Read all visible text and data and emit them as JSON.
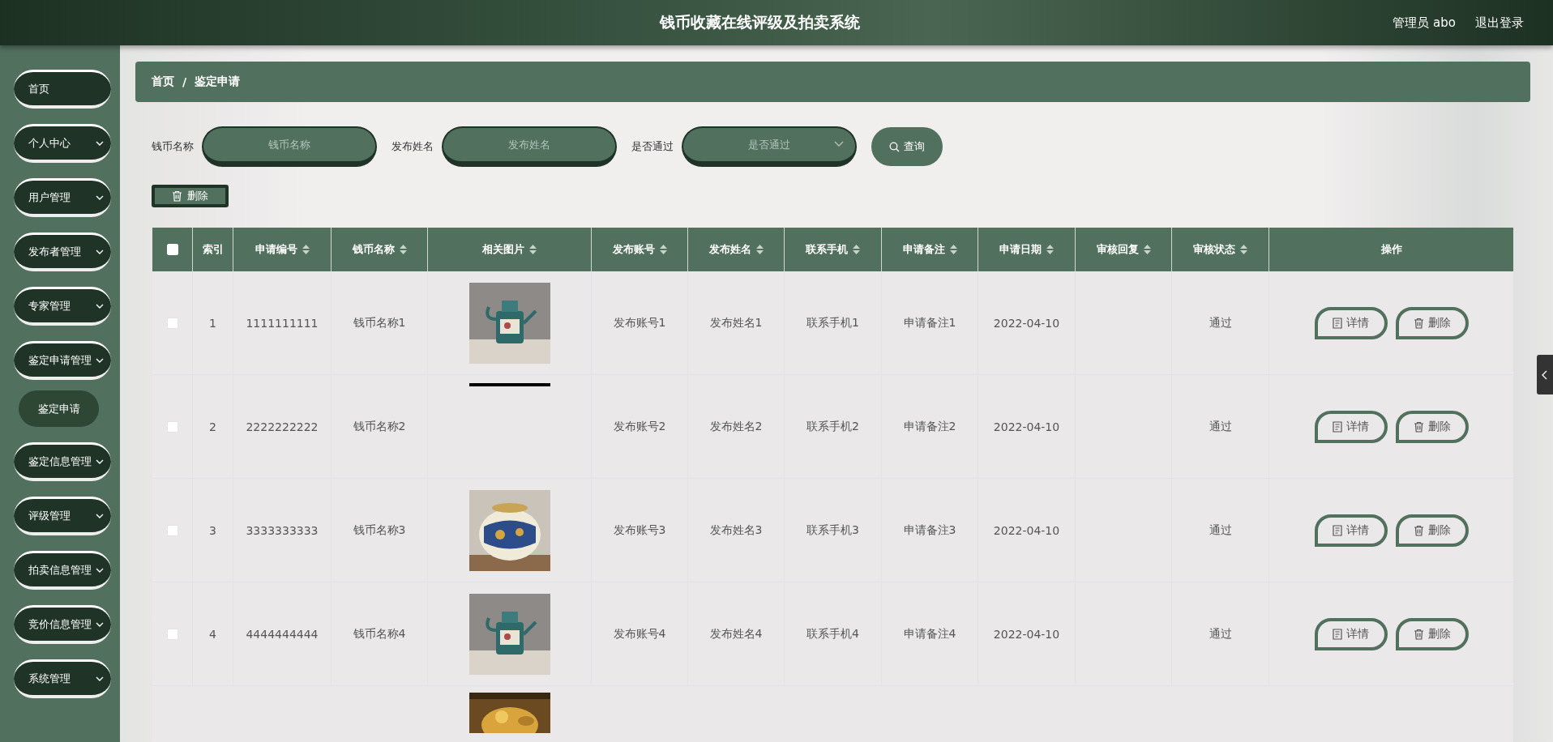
{
  "header": {
    "title": "钱币收藏在线评级及拍卖系统",
    "user": "管理员 abo",
    "logout": "退出登录"
  },
  "sidebar": {
    "items": [
      {
        "label": "首页",
        "expandable": false
      },
      {
        "label": "个人中心",
        "expandable": true
      },
      {
        "label": "用户管理",
        "expandable": true
      },
      {
        "label": "发布者管理",
        "expandable": true
      },
      {
        "label": "专家管理",
        "expandable": true
      },
      {
        "label": "鉴定申请管理",
        "expandable": true,
        "children": [
          {
            "label": "鉴定申请"
          }
        ]
      },
      {
        "label": "鉴定信息管理",
        "expandable": true
      },
      {
        "label": "评级管理",
        "expandable": true
      },
      {
        "label": "拍卖信息管理",
        "expandable": true
      },
      {
        "label": "竞价信息管理",
        "expandable": true
      },
      {
        "label": "系统管理",
        "expandable": true
      }
    ]
  },
  "breadcrumb": [
    "首页",
    "/",
    "鉴定申请"
  ],
  "search": {
    "fields": [
      {
        "label": "钱币名称",
        "placeholder": "钱币名称",
        "kind": "input"
      },
      {
        "label": "发布姓名",
        "placeholder": "发布姓名",
        "kind": "input"
      },
      {
        "label": "是否通过",
        "placeholder": "是否通过",
        "kind": "select"
      }
    ],
    "button": "查询"
  },
  "bulk_delete": "删除",
  "table": {
    "header_checked": false,
    "columns": [
      {
        "label": "索引",
        "sortable": false
      },
      {
        "label": "申请编号",
        "sortable": true
      },
      {
        "label": "钱币名称",
        "sortable": true
      },
      {
        "label": "相关图片",
        "sortable": true
      },
      {
        "label": "发布账号",
        "sortable": true
      },
      {
        "label": "发布姓名",
        "sortable": true
      },
      {
        "label": "联系手机",
        "sortable": true
      },
      {
        "label": "申请备注",
        "sortable": true
      },
      {
        "label": "申请日期",
        "sortable": true
      },
      {
        "label": "审核回复",
        "sortable": true
      },
      {
        "label": "审核状态",
        "sortable": true
      },
      {
        "label": "操作",
        "sortable": false
      }
    ],
    "rows": [
      {
        "checked": false,
        "index": "1",
        "number": "1111111111",
        "coin": "钱币名称1",
        "picture": {
          "kind": "picture"
        },
        "account": "发布账号1",
        "name": "发布姓名1",
        "phone": "联系手机1",
        "note": "申请备注1",
        "date": "2022-04-10",
        "status": "通过",
        "actions": [
          "详情",
          "删除"
        ]
      },
      {
        "checked": false,
        "index": "2",
        "number": "2222222222",
        "coin": "钱币名称2",
        "picture": {
          "kind": "broken"
        },
        "account": "发布账号2",
        "name": "发布姓名2",
        "phone": "联系手机2",
        "note": "申请备注2",
        "date": "2022-04-10",
        "status": "通过",
        "actions": [
          "详情",
          "删除"
        ]
      },
      {
        "checked": false,
        "index": "3",
        "number": "3333333333",
        "coin": "钱币名称3",
        "picture": {
          "kind": "picture"
        },
        "account": "发布账号3",
        "name": "发布姓名3",
        "phone": "联系手机3",
        "note": "申请备注3",
        "date": "2022-04-10",
        "status": "通过",
        "actions": [
          "详情",
          "删除"
        ]
      },
      {
        "checked": false,
        "index": "4",
        "number": "4444444444",
        "coin": "钱币名称4",
        "picture": {
          "kind": "picture"
        },
        "account": "发布账号4",
        "name": "发布姓名4",
        "phone": "联系手机4",
        "note": "申请备注4",
        "date": "2022-04-10",
        "status": "通过",
        "actions": [
          "详情",
          "删除"
        ]
      }
    ],
    "partial_row": {
      "kind": "picture"
    }
  }
}
